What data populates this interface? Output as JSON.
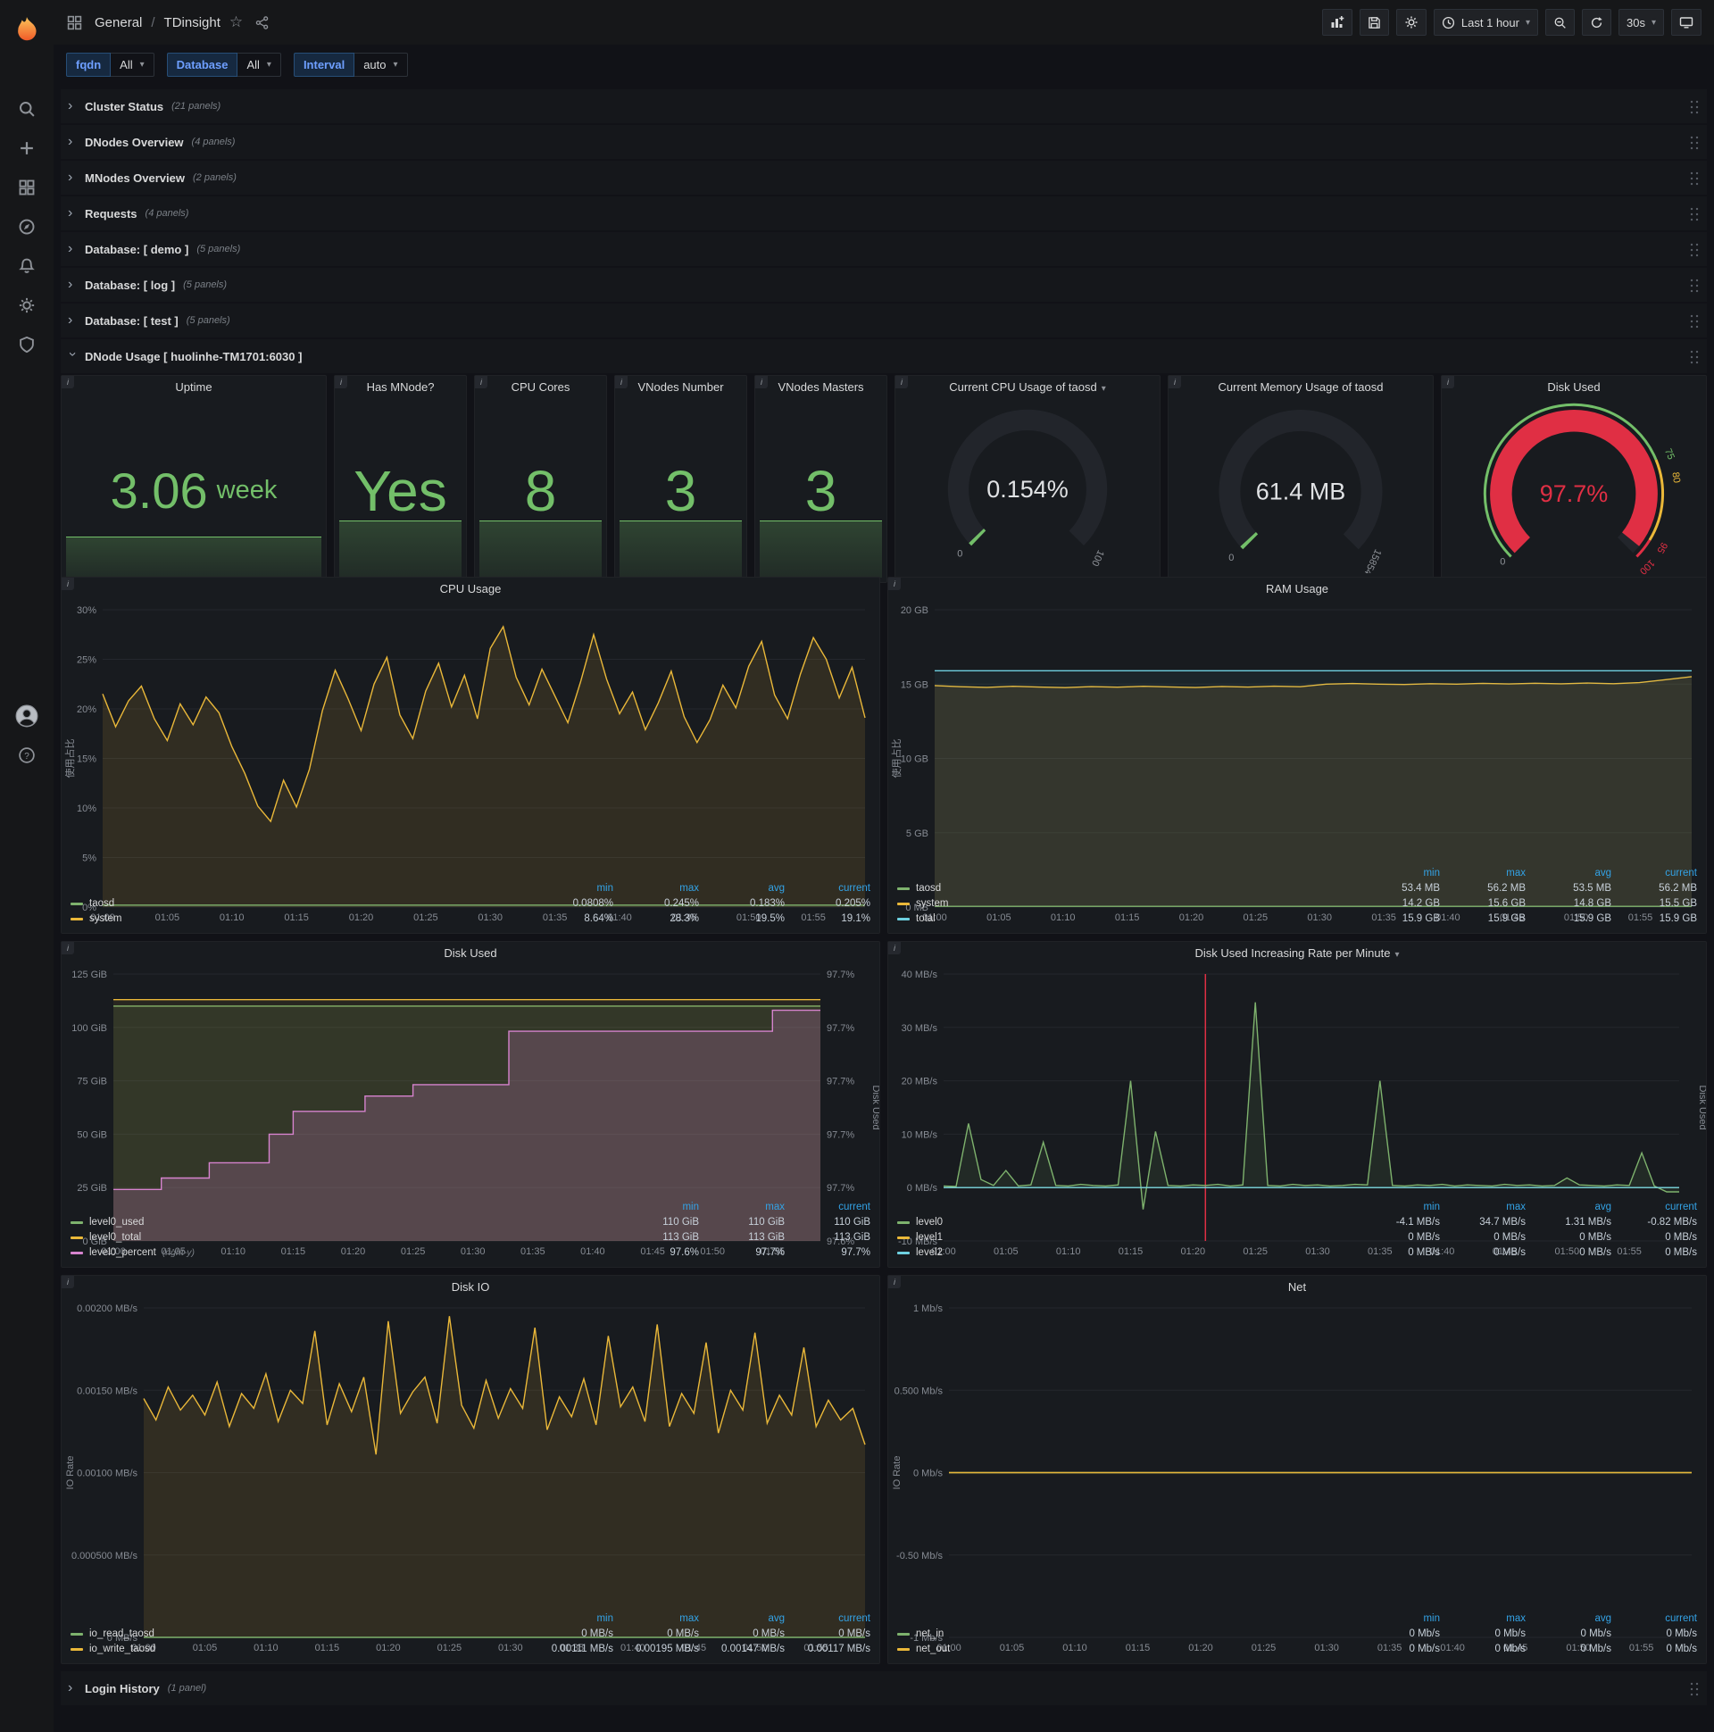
{
  "icons": {
    "star": "☆",
    "caret_down": "▾",
    "chevron_right": "›",
    "info": "i"
  },
  "topnav": {
    "section": "General",
    "slash": "/",
    "title": "TDinsight",
    "time_range": "Last 1 hour",
    "refresh": "30s"
  },
  "variables": [
    {
      "label": "fqdn",
      "value": "All"
    },
    {
      "label": "Database",
      "value": "All"
    },
    {
      "label": "Interval",
      "value": "auto"
    }
  ],
  "rows": [
    {
      "title": "Cluster Status",
      "count": "(21 panels)"
    },
    {
      "title": "DNodes Overview",
      "count": "(4 panels)"
    },
    {
      "title": "MNodes Overview",
      "count": "(2 panels)"
    },
    {
      "title": "Requests",
      "count": "(4 panels)"
    },
    {
      "title": "Database: [ demo ]",
      "count": "(5 panels)"
    },
    {
      "title": "Database: [ log ]",
      "count": "(5 panels)"
    },
    {
      "title": "Database: [ test ]",
      "count": "(5 panels)"
    }
  ],
  "expanded_row": {
    "title": "DNode Usage [ huolinhe-TM1701:6030 ]"
  },
  "login_row": {
    "title": "Login History",
    "count": "(1 panel)"
  },
  "stats": [
    {
      "title": "Uptime",
      "value": "3.06",
      "unit": "week"
    },
    {
      "title": "Has MNode?",
      "value": "Yes",
      "unit": ""
    },
    {
      "title": "CPU Cores",
      "value": "8",
      "unit": ""
    },
    {
      "title": "VNodes Number",
      "value": "3",
      "unit": ""
    },
    {
      "title": "VNodes Masters",
      "value": "3",
      "unit": ""
    }
  ],
  "gauges": [
    {
      "title": "Current CPU Usage of taosd",
      "value": "0.154%",
      "min_label": "0",
      "max_label": "100",
      "fraction": 0.00154,
      "value_color": "#e0e2e4",
      "arc_color": "#73bf69",
      "ticks": []
    },
    {
      "title": "Current Memory Usage of taosd",
      "value": "61.4 MB",
      "min_label": "0",
      "max_label": "15854",
      "fraction": 0.0039,
      "value_color": "#e0e2e4",
      "arc_color": "#73bf69",
      "ticks": []
    },
    {
      "title": "Disk Used",
      "value": "97.7%",
      "min_label": "0",
      "max_label": "",
      "fraction": 0.977,
      "value_color": "#e02f44",
      "arc_color": "#e02f44",
      "ticks": [
        {
          "f": 0.75,
          "t": "75",
          "c": "#73bf69"
        },
        {
          "f": 0.8,
          "t": "80",
          "c": "#eab839"
        },
        {
          "f": 0.95,
          "t": "95",
          "c": "#e02f44"
        },
        {
          "f": 1.0,
          "t": "100",
          "c": "#e02f44"
        }
      ],
      "outer": [
        {
          "f0": 0,
          "f1": 0.75,
          "c": "#73bf69"
        },
        {
          "f0": 0.75,
          "f1": 0.95,
          "c": "#eab839"
        },
        {
          "f0": 0.95,
          "f1": 1,
          "c": "#e02f44"
        }
      ]
    }
  ],
  "time_ticks": [
    "01:00",
    "01:05",
    "01:10",
    "01:15",
    "01:20",
    "01:25",
    "01:30",
    "01:35",
    "01:40",
    "01:45",
    "01:50",
    "01:55"
  ],
  "charts": {
    "cpu": {
      "type": "line",
      "title": "CPU Usage",
      "ylabel": "使用占比",
      "ml": 46,
      "mr": 16,
      "ymin": 0,
      "ymax": 30,
      "yticks": [
        {
          "v": 0,
          "t": "0%"
        },
        {
          "v": 5,
          "t": "5%"
        },
        {
          "v": 10,
          "t": "10%"
        },
        {
          "v": 15,
          "t": "15%"
        },
        {
          "v": 20,
          "t": "20%"
        },
        {
          "v": 25,
          "t": "25%"
        },
        {
          "v": 30,
          "t": "30%"
        }
      ],
      "series": [
        {
          "name": "system",
          "color": "#eab839",
          "fill": 0.12,
          "values": [
            21.5,
            18.2,
            20.8,
            22.3,
            19,
            16.8,
            20.5,
            18.4,
            21.2,
            19.6,
            16.2,
            13.5,
            10.2,
            8.64,
            12.8,
            10.1,
            13.9,
            19.8,
            23.9,
            21,
            17.8,
            22.5,
            25.2,
            19.4,
            17,
            21.8,
            24.6,
            20.2,
            23.4,
            19,
            26.1,
            28.3,
            23.2,
            20.4,
            24,
            21.3,
            18.6,
            22.8,
            27.5,
            23,
            19.5,
            21.7,
            17.9,
            20.6,
            23.8,
            19.2,
            16.6,
            18.9,
            22.4,
            20.1,
            24.3,
            26.8,
            21.4,
            19,
            23.5,
            27.2,
            25,
            21.1,
            24.2,
            19.1
          ]
        },
        {
          "name": "taosd",
          "color": "#7eb26d",
          "fill": 0.08,
          "values": [
            0.2,
            0.2
          ]
        }
      ],
      "legend": {
        "cols": [
          "min",
          "max",
          "avg",
          "current"
        ],
        "rows": [
          {
            "name": "taosd",
            "color": "#7eb26d",
            "values": [
              "0.0808%",
              "0.245%",
              "0.183%",
              "0.205%"
            ]
          },
          {
            "name": "system",
            "color": "#eab839",
            "values": [
              "8.64%",
              "28.3%",
              "19.5%",
              "19.1%"
            ]
          }
        ]
      }
    },
    "ram": {
      "type": "line",
      "title": "RAM Usage",
      "ylabel": "使用占比",
      "ml": 52,
      "mr": 16,
      "ymin": 0,
      "ymax": 20,
      "yticks": [
        {
          "v": 0,
          "t": "0 MB"
        },
        {
          "v": 5,
          "t": "5 GB"
        },
        {
          "v": 10,
          "t": "10 GB"
        },
        {
          "v": 15,
          "t": "15 GB"
        },
        {
          "v": 20,
          "t": "20 GB"
        }
      ],
      "series": [
        {
          "name": "system",
          "color": "#eab839",
          "fill": 0.12,
          "values": [
            14.9,
            14.82,
            14.78,
            14.85,
            14.8,
            14.76,
            14.83,
            14.79,
            14.85,
            14.81,
            14.77,
            14.84,
            14.8,
            14.86,
            14.82,
            15,
            15.04,
            15,
            14.97,
            15.03,
            15,
            15.05,
            15.01,
            15.06,
            15.02,
            15.07,
            15.03,
            15.1,
            15.3,
            15.5
          ]
        },
        {
          "name": "total",
          "color": "#6ed0e0",
          "fill": 0.06,
          "values": [
            15.9,
            15.9
          ]
        },
        {
          "name": "taosd",
          "color": "#7eb26d",
          "values": [
            0.05,
            0.05
          ]
        }
      ],
      "legend": {
        "cols": [
          "min",
          "max",
          "avg",
          "current"
        ],
        "rows": [
          {
            "name": "taosd",
            "color": "#7eb26d",
            "values": [
              "53.4 MB",
              "56.2 MB",
              "53.5 MB",
              "56.2 MB"
            ]
          },
          {
            "name": "system",
            "color": "#eab839",
            "values": [
              "14.2 GB",
              "15.6 GB",
              "14.8 GB",
              "15.5 GB"
            ]
          },
          {
            "name": "total",
            "color": "#6ed0e0",
            "values": [
              "15.9 GB",
              "15.9 GB",
              "15.9 GB",
              "15.9 GB"
            ]
          }
        ]
      }
    },
    "disk_used": {
      "type": "line",
      "title": "Disk Used",
      "ml": 58,
      "mr": 66,
      "ymin": 0,
      "ymax": 125,
      "y2min": 97.58,
      "y2max": 97.72,
      "yticks": [
        {
          "v": 0,
          "t": "0 GiB"
        },
        {
          "v": 25,
          "t": "25 GiB"
        },
        {
          "v": 50,
          "t": "50 GiB"
        },
        {
          "v": 75,
          "t": "75 GiB"
        },
        {
          "v": 100,
          "t": "100 GiB"
        },
        {
          "v": 125,
          "t": "125 GiB"
        }
      ],
      "yticks_right": [
        "97.6%",
        "97.7%",
        "97.7%",
        "97.7%",
        "97.7%",
        "97.7%"
      ],
      "right_label": "Disk Used",
      "series": [
        {
          "name": "level0_used",
          "color": "#7eb26d",
          "fill": 0.12,
          "values": [
            110,
            110
          ]
        },
        {
          "name": "level0_total",
          "color": "#eab839",
          "fill": 0.08,
          "values": [
            113,
            113
          ]
        },
        {
          "name": "level0_percent",
          "color": "#d683ce",
          "axis": "right",
          "step": true,
          "fill": 0.22,
          "steps": [
            [
              4,
              97.607
            ],
            [
              4,
              97.613
            ],
            [
              5,
              97.621
            ],
            [
              2,
              97.636
            ],
            [
              6,
              97.648
            ],
            [
              4,
              97.656
            ],
            [
              8,
              97.662
            ],
            [
              22,
              97.69
            ],
            [
              5,
              97.701
            ]
          ]
        }
      ],
      "legend": {
        "cols": [
          "min",
          "max",
          "current"
        ],
        "rows": [
          {
            "name": "level0_used",
            "color": "#7eb26d",
            "values": [
              "110 GiB",
              "110 GiB",
              "110 GiB"
            ]
          },
          {
            "name": "level0_total",
            "color": "#eab839",
            "values": [
              "113 GiB",
              "113 GiB",
              "113 GiB"
            ]
          },
          {
            "name": "level0_percent",
            "note": "(right-y)",
            "color": "#d683ce",
            "values": [
              "97.6%",
              "97.7%",
              "97.7%"
            ]
          }
        ]
      }
    },
    "disk_rate": {
      "type": "line",
      "title": "Disk Used Increasing Rate per Minute",
      "ml": 62,
      "mr": 30,
      "ymin": -10,
      "ymax": 40,
      "annotation_x": 21,
      "yticks": [
        {
          "v": -10,
          "t": "-10 MB/s"
        },
        {
          "v": 0,
          "t": "0 MB/s"
        },
        {
          "v": 10,
          "t": "10 MB/s"
        },
        {
          "v": 20,
          "t": "20 MB/s"
        },
        {
          "v": 30,
          "t": "30 MB/s"
        },
        {
          "v": 40,
          "t": "40 MB/s"
        }
      ],
      "right_label": "Disk Used",
      "series": [
        {
          "name": "level0",
          "color": "#7eb26d",
          "fill": 0.1,
          "values": [
            0.3,
            0.2,
            12,
            1.5,
            0.4,
            3.2,
            0.3,
            0.5,
            8.5,
            0.4,
            0.3,
            0.6,
            0.4,
            0.3,
            0.5,
            20,
            -4.1,
            10.5,
            0.4,
            0.3,
            0.5,
            0.4,
            0.6,
            0.3,
            0.5,
            34.7,
            0.4,
            0.3,
            0.6,
            0.4,
            0.5,
            0.3,
            0.4,
            0.6,
            0.5,
            20,
            0.4,
            0.3,
            0.5,
            0.4,
            0.6,
            0.3,
            0.5,
            0.4,
            0.3,
            0.6,
            0.4,
            0.5,
            0.3,
            0.4,
            1.8,
            0.5,
            0.4,
            0.3,
            0.5,
            0.4,
            6.5,
            0.3,
            -0.8,
            -0.8
          ]
        },
        {
          "name": "level1",
          "color": "#eab839",
          "values": [
            0,
            0
          ]
        },
        {
          "name": "level2",
          "color": "#6ed0e0",
          "values": [
            0,
            0
          ]
        }
      ],
      "legend": {
        "cols": [
          "min",
          "max",
          "avg",
          "current"
        ],
        "rows": [
          {
            "name": "level0",
            "color": "#7eb26d",
            "values": [
              "-4.1 MB/s",
              "34.7 MB/s",
              "1.31 MB/s",
              "-0.82 MB/s"
            ]
          },
          {
            "name": "level1",
            "color": "#eab839",
            "values": [
              "0 MB/s",
              "0 MB/s",
              "0 MB/s",
              "0 MB/s"
            ]
          },
          {
            "name": "level2",
            "color": "#6ed0e0",
            "values": [
              "0 MB/s",
              "0 MB/s",
              "0 MB/s",
              "0 MB/s"
            ]
          }
        ]
      }
    },
    "disk_io": {
      "type": "line",
      "title": "Disk IO",
      "ylabel": "IO Rate",
      "ml": 92,
      "mr": 16,
      "ymin": 0,
      "ymax": 0.002,
      "yticks": [
        {
          "v": 0,
          "t": "0 MB/s"
        },
        {
          "v": 0.0005,
          "t": "0.000500 MB/s"
        },
        {
          "v": 0.001,
          "t": "0.00100 MB/s"
        },
        {
          "v": 0.0015,
          "t": "0.00150 MB/s"
        },
        {
          "v": 0.002,
          "t": "0.00200 MB/s"
        }
      ],
      "series": [
        {
          "name": "io_write_taosd",
          "color": "#eab839",
          "fill": 0.12,
          "values": [
            0.00145,
            0.00132,
            0.00152,
            0.00138,
            0.00147,
            0.00135,
            0.00155,
            0.00128,
            0.00148,
            0.00139,
            0.0016,
            0.00131,
            0.0015,
            0.00142,
            0.00186,
            0.00129,
            0.00154,
            0.00137,
            0.00158,
            0.00111,
            0.00192,
            0.00136,
            0.00149,
            0.00158,
            0.0013,
            0.00195,
            0.00141,
            0.00127,
            0.00156,
            0.00133,
            0.00151,
            0.00139,
            0.00188,
            0.00126,
            0.00146,
            0.00134,
            0.00157,
            0.00129,
            0.00183,
            0.0014,
            0.00152,
            0.00131,
            0.0019,
            0.00128,
            0.00148,
            0.00136,
            0.00179,
            0.00124,
            0.0015,
            0.00138,
            0.00185,
            0.0013,
            0.00147,
            0.00135,
            0.00176,
            0.00128,
            0.00144,
            0.00132,
            0.00139,
            0.00117
          ]
        },
        {
          "name": "io_read_taosd",
          "color": "#7eb26d",
          "values": [
            0,
            0
          ]
        }
      ],
      "legend": {
        "cols": [
          "min",
          "max",
          "avg",
          "current"
        ],
        "rows": [
          {
            "name": "io_read_taosd",
            "color": "#7eb26d",
            "values": [
              "0 MB/s",
              "0 MB/s",
              "0 MB/s",
              "0 MB/s"
            ]
          },
          {
            "name": "io_write_taosd",
            "color": "#eab839",
            "values": [
              "0.00111 MB/s",
              "0.00195 MB/s",
              "0.00147 MB/s",
              "0.00117 MB/s"
            ]
          }
        ]
      }
    },
    "net": {
      "type": "line",
      "title": "Net",
      "ylabel": "IO Rate",
      "ml": 68,
      "mr": 16,
      "ymin": -1,
      "ymax": 1,
      "yticks": [
        {
          "v": -1,
          "t": "-1 Mb/s"
        },
        {
          "v": -0.5,
          "t": "-0.50 Mb/s"
        },
        {
          "v": 0,
          "t": "0 Mb/s"
        },
        {
          "v": 0.5,
          "t": "0.500 Mb/s"
        },
        {
          "v": 1,
          "t": "1 Mb/s"
        }
      ],
      "series": [
        {
          "name": "net_in",
          "color": "#7eb26d",
          "values": [
            0,
            0
          ]
        },
        {
          "name": "net_out",
          "color": "#eab839",
          "values": [
            0,
            0
          ]
        }
      ],
      "legend": {
        "cols": [
          "min",
          "max",
          "avg",
          "current"
        ],
        "rows": [
          {
            "name": "net_in",
            "color": "#7eb26d",
            "values": [
              "0 Mb/s",
              "0 Mb/s",
              "0 Mb/s",
              "0 Mb/s"
            ]
          },
          {
            "name": "net_out",
            "color": "#eab839",
            "values": [
              "0 Mb/s",
              "0 Mb/s",
              "0 Mb/s",
              "0 Mb/s"
            ]
          }
        ]
      }
    }
  }
}
